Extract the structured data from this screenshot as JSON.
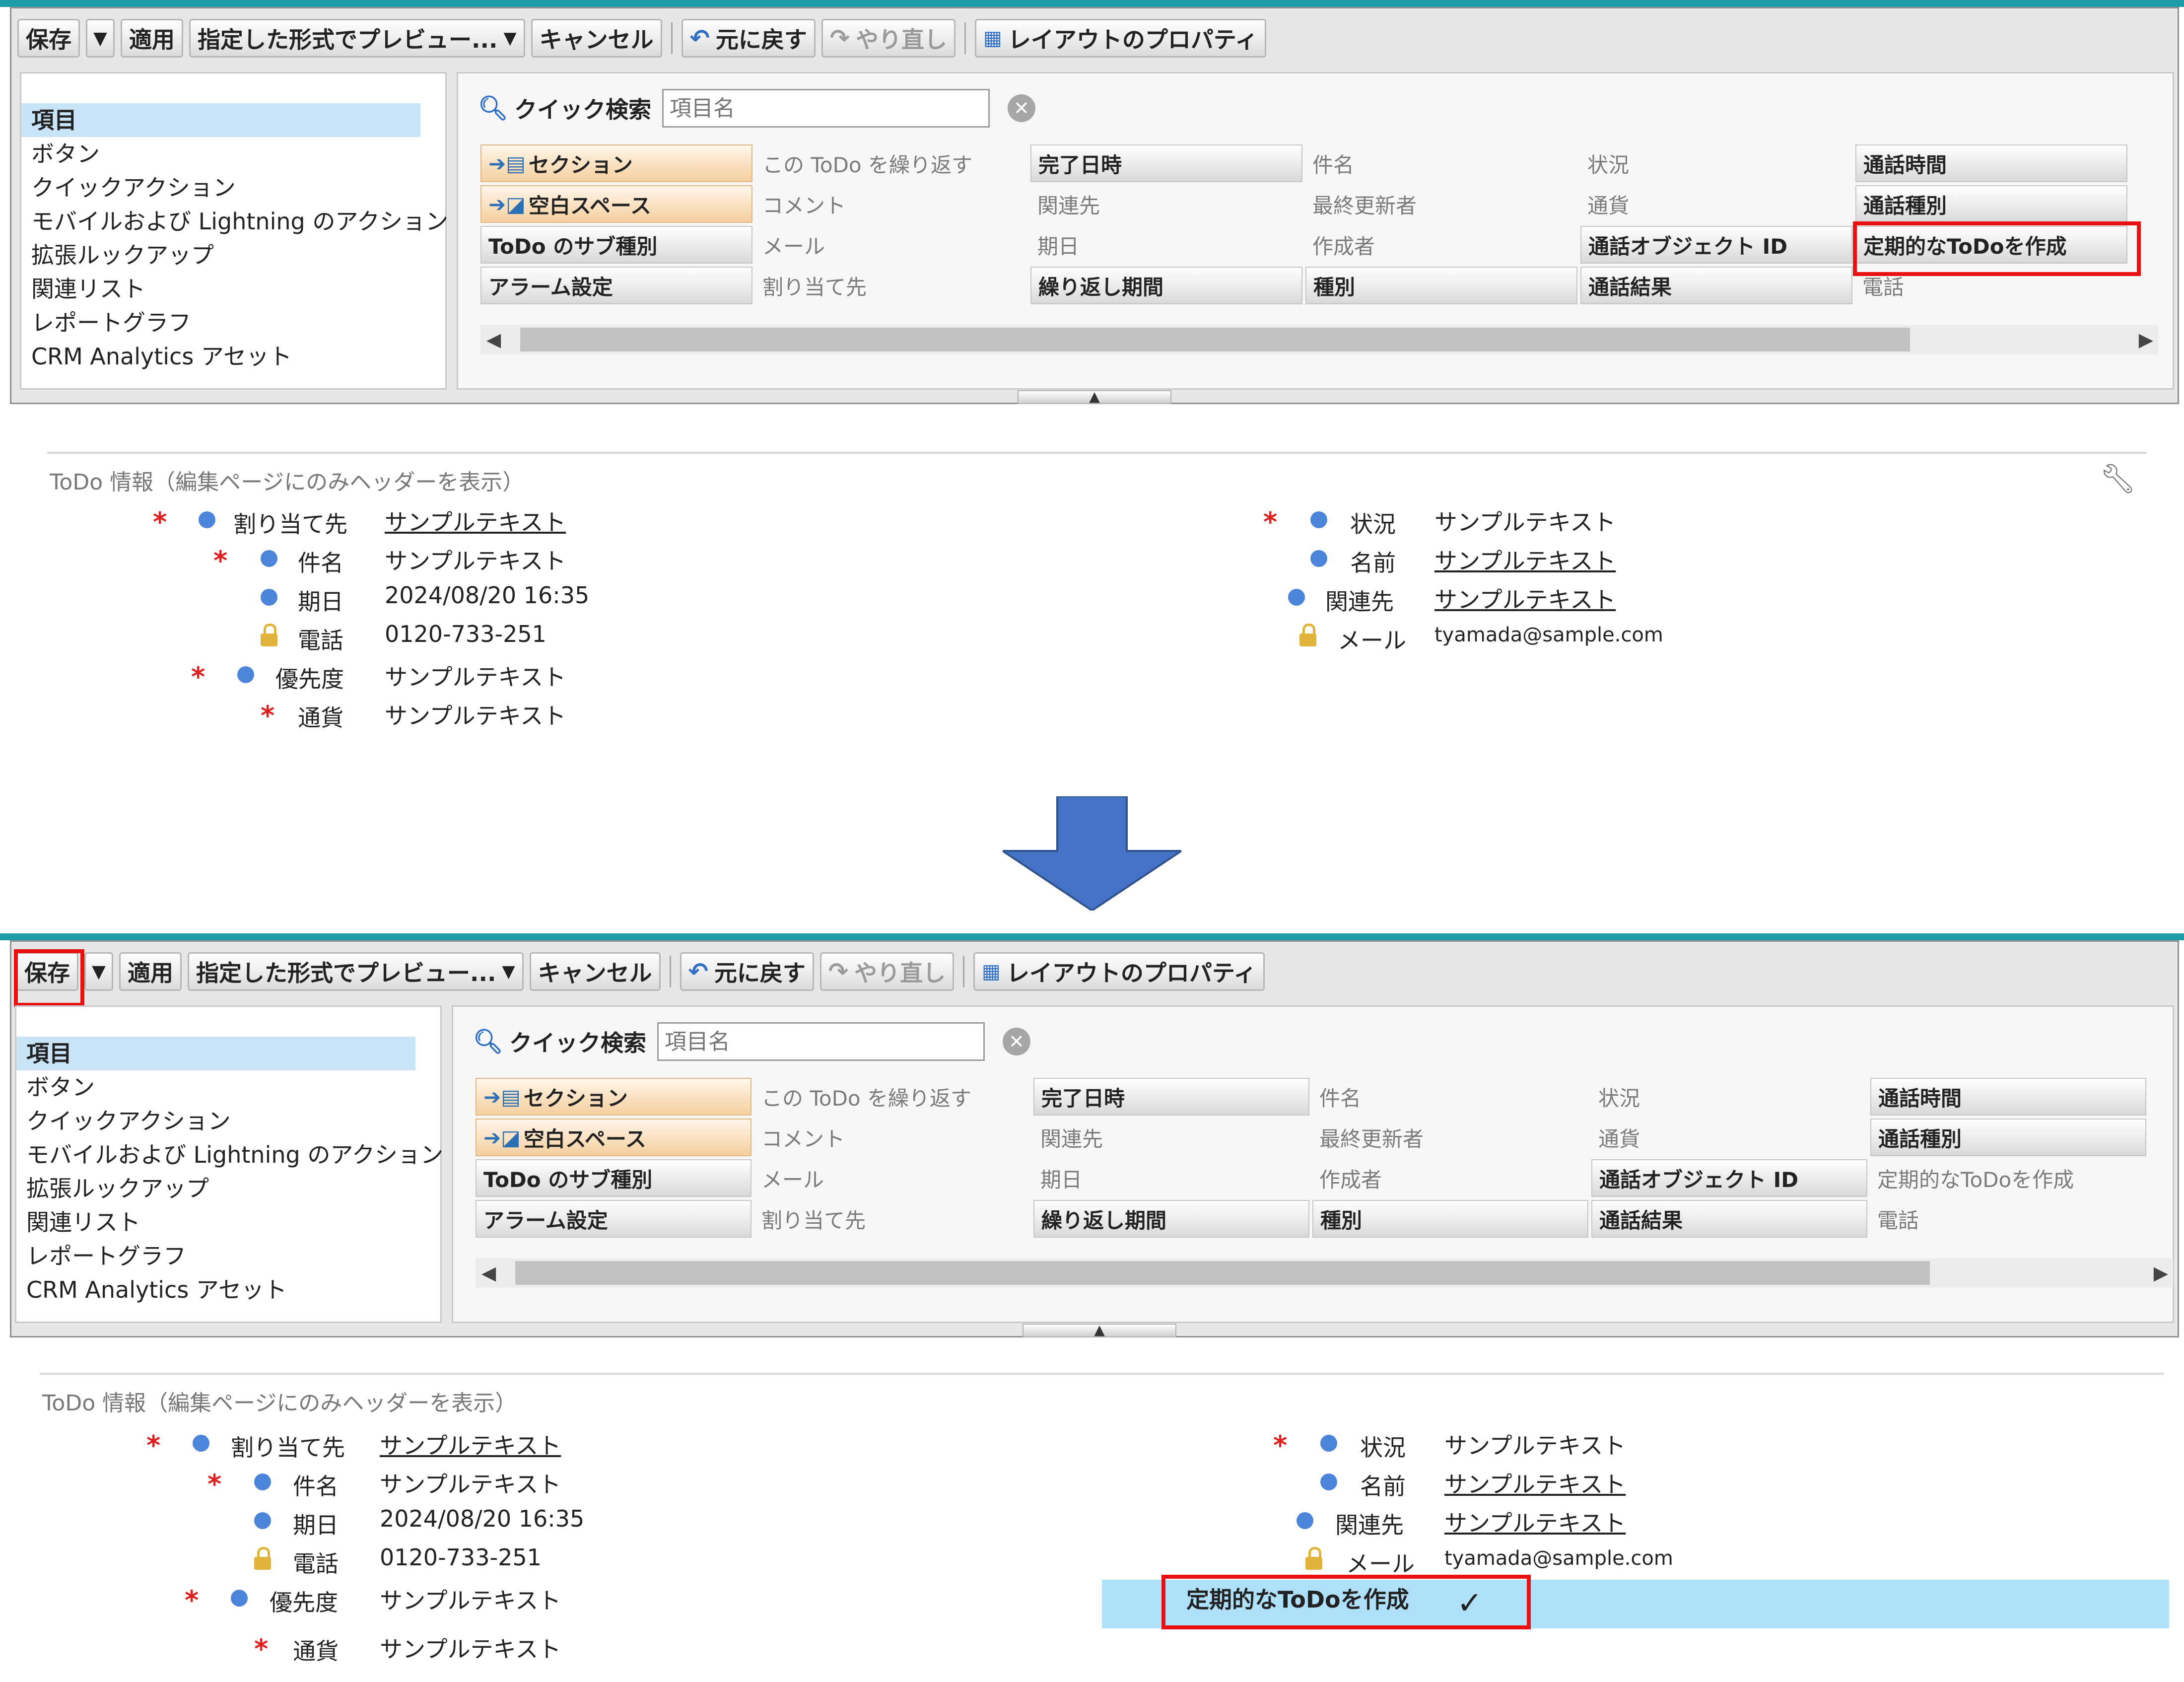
{
  "toolbar": {
    "save": "保存",
    "apply": "適用",
    "preview": "指定した形式でプレビュー...",
    "cancel": "キャンセル",
    "undo": "元に戻す",
    "redo": "やり直し",
    "layout_props": "レイアウトのプロパティ"
  },
  "nav": [
    "項目",
    "ボタン",
    "クイックアクション",
    "モバイルおよび Lightning のアクション",
    "拡張ルックアップ",
    "関連リスト",
    "レポートグラフ",
    "CRM Analytics アセット"
  ],
  "quick_search": {
    "label": "クイック検索",
    "placeholder": "項目名"
  },
  "palette": {
    "rows": [
      [
        "セクション",
        "この ToDo を繰り返す",
        "完了日時",
        "件名",
        "状況",
        "通話時間"
      ],
      [
        "空白スペース",
        "コメント",
        "関連先",
        "最終更新者",
        "通貨",
        "通話種別"
      ],
      [
        "ToDo のサブ種別",
        "メール",
        "期日",
        "作成者",
        "通話オブジェクト ID",
        "定期的なToDoを作成"
      ],
      [
        "アラーム設定",
        "割り当て先",
        "繰り返し期間",
        "種別",
        "通話結果",
        "電話"
      ]
    ]
  },
  "section_title": "ToDo 情報（編集ページにのみヘッダーを表示）",
  "fields": {
    "assignee": {
      "label": "割り当て先",
      "value": "サンプルテキスト"
    },
    "subject": {
      "label": "件名",
      "value": "サンプルテキスト"
    },
    "due": {
      "label": "期日",
      "value": "2024/08/20 16:35"
    },
    "phone": {
      "label": "電話",
      "value": "0120-733-251"
    },
    "priority": {
      "label": "優先度",
      "value": "サンプルテキスト"
    },
    "currency": {
      "label": "通貨",
      "value": "サンプルテキスト"
    },
    "status": {
      "label": "状況",
      "value": "サンプルテキスト"
    },
    "name": {
      "label": "名前",
      "value": "サンプルテキスト"
    },
    "related": {
      "label": "関連先",
      "value": "サンプルテキスト"
    },
    "email": {
      "label": "メール",
      "value": "tyamada@sample.com"
    }
  },
  "added_field": {
    "label": "定期的なToDoを作成",
    "value": "✓"
  },
  "colors": {
    "highlight": "#e81010",
    "arrow": "#4472c4",
    "added_row": "#aee0fa",
    "top_bar": "#1f9aa8"
  }
}
